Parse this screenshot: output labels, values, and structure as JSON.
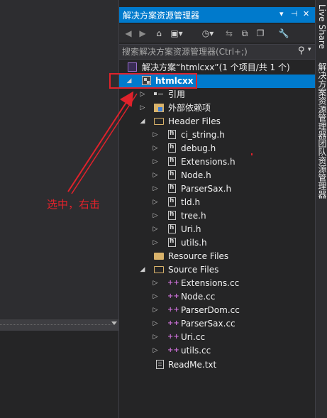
{
  "panel": {
    "title": "解决方案资源管理器",
    "title_buttons": {
      "dropdown": "▾",
      "pin": "⊣",
      "close": "✕"
    },
    "search": {
      "placeholder": "搜索解决方案资源管理器(Ctrl+;)",
      "value": ""
    }
  },
  "toolbar": {
    "icons": [
      "back-icon",
      "forward-icon",
      "home-icon",
      "switch-views-icon",
      "history-icon",
      "sync-icon",
      "collapse-all-icon",
      "show-all-files-icon",
      "properties-icon"
    ]
  },
  "tree": {
    "solution": "解决方案“htmlcxx”(1 个项目/共 1 个)",
    "project": "htmlcxx",
    "references": "引用",
    "external_deps": "外部依赖项",
    "header_files": {
      "label": "Header Files",
      "items": [
        "ci_string.h",
        "debug.h",
        "Extensions.h",
        "Node.h",
        "ParserSax.h",
        "tld.h",
        "tree.h",
        "Uri.h",
        "utils.h"
      ]
    },
    "resource_files": "Resource Files",
    "source_files": {
      "label": "Source Files",
      "items": [
        "Extensions.cc",
        "Node.cc",
        "ParserDom.cc",
        "ParserSax.cc",
        "Uri.cc",
        "utils.cc"
      ]
    },
    "readme": "ReadMe.txt"
  },
  "side_tabs": [
    "Live Share",
    "解决方案资源管理器",
    "团队资源管理器"
  ],
  "annotation": {
    "text": "选中，右击",
    "color": "#e0222b"
  },
  "colors": {
    "accent": "#007acc",
    "panel_bg": "#252526",
    "chrome_bg": "#2d2d30"
  }
}
